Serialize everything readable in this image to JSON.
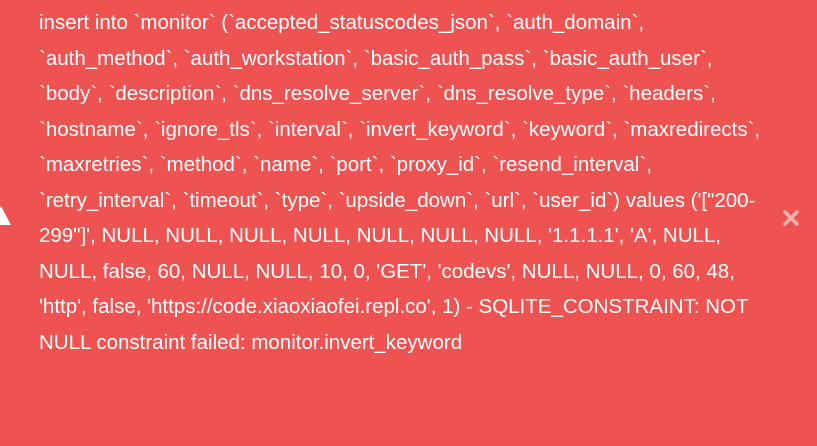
{
  "toast": {
    "type": "error",
    "icon": "warning-icon",
    "message": "insert into `monitor` (`accepted_statuscodes_json`, `auth_domain`, `auth_method`, `auth_workstation`, `basic_auth_pass`, `basic_auth_user`, `body`, `description`, `dns_resolve_server`, `dns_resolve_type`, `headers`, `hostname`, `ignore_tls`, `interval`, `invert_keyword`, `keyword`, `maxredirects`, `maxretries`, `method`, `name`, `port`, `proxy_id`, `resend_interval`, `retry_interval`, `timeout`, `type`, `upside_down`, `url`, `user_id`) values ('[\"200-299\"]', NULL, NULL, NULL, NULL, NULL, NULL, NULL, '1.1.1.1', 'A', NULL, NULL, false, 60, NULL, NULL, 10, 0, 'GET', 'codevs', NULL, NULL, 0, 60, 48, 'http', false, 'https://code.xiaoxiaofei.repl.co', 1) - SQLITE_CONSTRAINT: NOT NULL constraint failed: monitor.invert_keyword",
    "close_icon": "close-icon"
  },
  "colors": {
    "background": "#ee5352",
    "text": "#ffffff"
  }
}
